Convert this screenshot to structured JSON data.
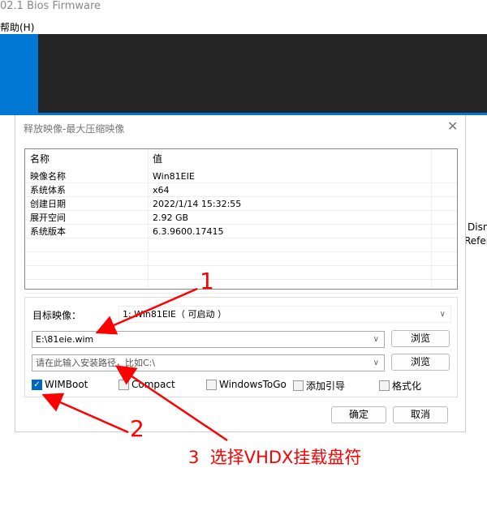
{
  "app": {
    "title": "02.1 Bios Firmware",
    "menu_help": "帮助(H)",
    "side_text1": "Disn",
    "side_text2": "Refer"
  },
  "dialog": {
    "title": "释放映像-最大压缩映像",
    "close_icon": "close-icon",
    "table": {
      "headers": [
        "名称",
        "值"
      ],
      "rows": [
        [
          "映像名称",
          "Win81EIE"
        ],
        [
          "系统体系",
          "x64"
        ],
        [
          "创建日期",
          "2022/1/14 15:32:55"
        ],
        [
          "展开空间",
          "2.92 GB"
        ],
        [
          "系统版本",
          "6.3.9600.17415"
        ]
      ]
    },
    "target_label": "目标映像：",
    "target_value": "1: Win81EIE（ 可启动 ）",
    "source_path": "E:\\81eie.wim",
    "install_placeholder": "请在此输入安装路径，比如C:\\",
    "browse": "浏览",
    "options": [
      {
        "label": "WIMBoot",
        "checked": true
      },
      {
        "label": "Compact",
        "checked": false
      },
      {
        "label": "WindowsToGo",
        "checked": false
      },
      {
        "label": "添加引导",
        "checked": false
      },
      {
        "label": "格式化",
        "checked": false
      }
    ],
    "ok": "确定",
    "cancel": "取消"
  },
  "annotations": {
    "a1": "1",
    "a2": "2",
    "a3": "3  选择VHDX挂载盘符",
    "color": "#ff0000"
  }
}
